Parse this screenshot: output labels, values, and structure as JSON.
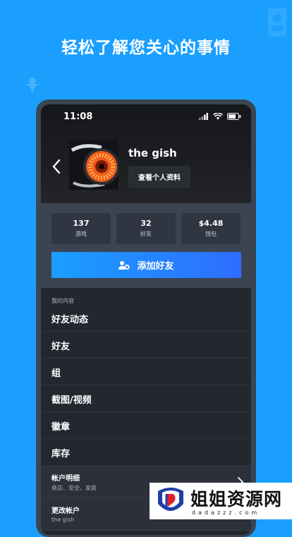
{
  "headline": "轻松了解您关心的事情",
  "status": {
    "time": "11:08"
  },
  "profile": {
    "name": "the gish",
    "view_profile_label": "查看个人资料"
  },
  "stats": [
    {
      "value": "137",
      "label": "游戏"
    },
    {
      "value": "32",
      "label": "好友"
    },
    {
      "value": "$4.48",
      "label": "钱包"
    }
  ],
  "add_friend_label": "添加好友",
  "section_label": "我的内容",
  "menu": [
    "好友动态",
    "好友",
    "组",
    "截图/视频",
    "徽章",
    "库存"
  ],
  "account": [
    {
      "title": "帐户明细",
      "subtitle": "商店、安全、家庭"
    },
    {
      "title": "更改帐户",
      "subtitle": "the gish"
    }
  ],
  "watermark": {
    "text": "姐姐资源网",
    "url": "dadazzz.com"
  },
  "colors": {
    "background": "#1a9fff",
    "button_gradient_end": "#2f6dff",
    "screen": "#23272f"
  }
}
